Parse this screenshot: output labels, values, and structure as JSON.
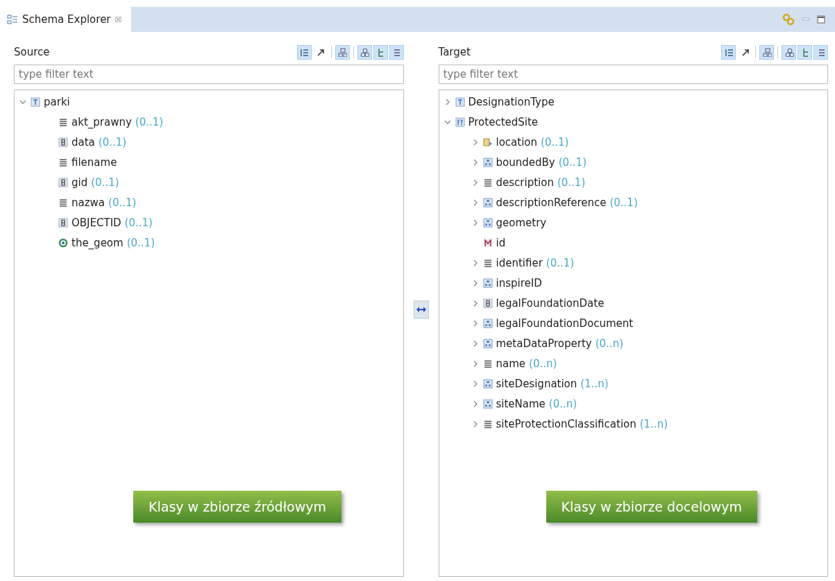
{
  "view_tab": {
    "title": "Schema Explorer",
    "close": "☒"
  },
  "panels": [
    {
      "title": "Source",
      "toolbar": [
        {
          "kind": "expand",
          "on": true
        },
        {
          "kind": "link",
          "on": false
        },
        {
          "kind": "types",
          "on": true
        },
        {
          "kind": "circles",
          "on": true
        },
        {
          "kind": "tree",
          "on": true
        },
        {
          "kind": "list",
          "on": true
        }
      ],
      "filter": {
        "placeholder": "type filter text"
      },
      "tree": [
        {
          "label": "parki",
          "kind": "type",
          "expanded": true,
          "children": [
            {
              "label": "akt_prawny",
              "card": "(0..1)",
              "kind": "string"
            },
            {
              "label": "data",
              "card": "(0..1)",
              "kind": "number"
            },
            {
              "label": "filename",
              "kind": "string"
            },
            {
              "label": "gid",
              "card": "(0..1)",
              "kind": "number"
            },
            {
              "label": "nazwa",
              "card": "(0..1)",
              "kind": "string"
            },
            {
              "label": "OBJECTID",
              "card": "(0..1)",
              "kind": "number"
            },
            {
              "label": "the_geom",
              "card": "(0..1)",
              "kind": "geometry"
            }
          ]
        }
      ],
      "callout": "Klasy w zbiorze źródłowym"
    },
    {
      "title": "Target",
      "toolbar": [
        {
          "kind": "expand",
          "on": true
        },
        {
          "kind": "link",
          "on": false
        },
        {
          "kind": "types",
          "on": true
        },
        {
          "kind": "circles",
          "on": true
        },
        {
          "kind": "tree",
          "on": true
        },
        {
          "kind": "list",
          "on": true
        }
      ],
      "filter": {
        "placeholder": "type filter text"
      },
      "tree": [
        {
          "label": "DesignationType",
          "kind": "type",
          "expanded": false
        },
        {
          "label": "ProtectedSite",
          "kind": "feature",
          "expanded": true,
          "children": [
            {
              "label": "location",
              "card": "(0..1)",
              "kind": "choice",
              "expanded": false
            },
            {
              "label": "boundedBy",
              "card": "(0..1)",
              "kind": "complex",
              "expanded": false
            },
            {
              "label": "description",
              "card": "(0..1)",
              "kind": "string",
              "expanded": false
            },
            {
              "label": "descriptionReference",
              "card": "(0..1)",
              "kind": "complex",
              "expanded": false
            },
            {
              "label": "geometry",
              "kind": "complex",
              "expanded": false
            },
            {
              "label": "id",
              "kind": "id"
            },
            {
              "label": "identifier",
              "card": "(0..1)",
              "kind": "string",
              "expanded": false
            },
            {
              "label": "inspireID",
              "kind": "complex",
              "expanded": false
            },
            {
              "label": "legalFoundationDate",
              "kind": "number",
              "expanded": false
            },
            {
              "label": "legalFoundationDocument",
              "kind": "complex",
              "expanded": false
            },
            {
              "label": "metaDataProperty",
              "card": "(0..n)",
              "kind": "complex",
              "expanded": false
            },
            {
              "label": "name",
              "card": "(0..n)",
              "kind": "string",
              "expanded": false
            },
            {
              "label": "siteDesignation",
              "card": "(1..n)",
              "kind": "complex",
              "expanded": false
            },
            {
              "label": "siteName",
              "card": "(0..n)",
              "kind": "complex",
              "expanded": false
            },
            {
              "label": "siteProtectionClassification",
              "card": "(1..n)",
              "kind": "string",
              "expanded": false
            }
          ]
        }
      ],
      "callout": "Klasy w zbiorze docelowym"
    }
  ]
}
